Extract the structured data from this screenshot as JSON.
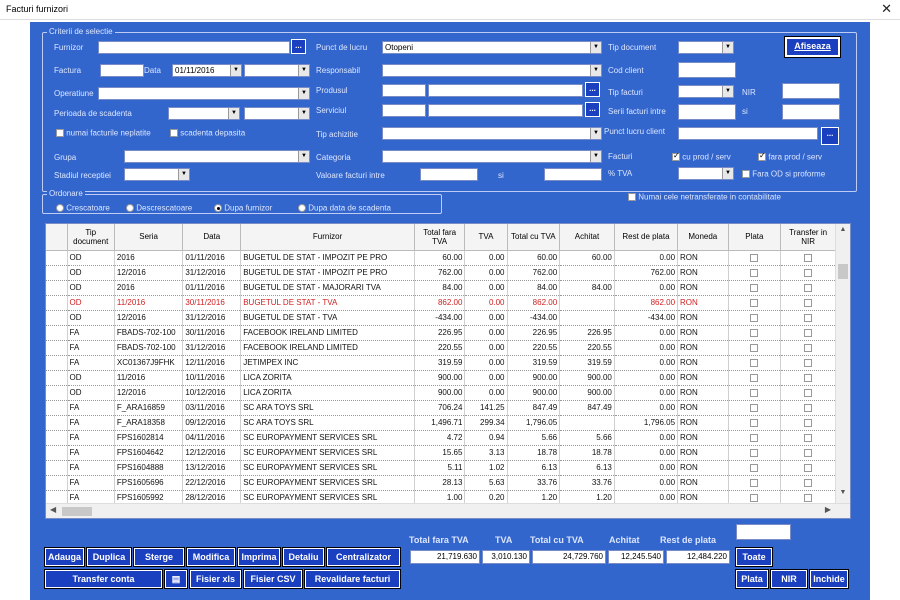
{
  "window": {
    "title": "Facturi furnizori",
    "close": "✕"
  },
  "criteria": {
    "caption": "Criterii de selectie",
    "furnizor_label": "Furnizor",
    "furnizor_value": "",
    "factura_label": "Factura",
    "data_label": "Data",
    "data_value": "01/11/2016",
    "operatiune_label": "Operatiune",
    "perioada_label": "Perioada de scadenta",
    "numai_neplatite": "numai facturile neplatite",
    "scadenta_depasita": "scadenta depasita",
    "grupa_label": "Grupa",
    "stadiul_label": "Stadiul receptiei",
    "punct_label": "Punct de lucru",
    "punct_value": "Otopeni",
    "responsabil_label": "Responsabil",
    "produsul_label": "Produsul",
    "serviciul_label": "Serviciul",
    "tip_achizitie_label": "Tip achizitie",
    "categoria_label": "Categoria",
    "valoare_label": "Valoare facturi intre",
    "si_label": "si",
    "tip_document_label": "Tip document",
    "cod_client_label": "Cod client",
    "tip_facturi_label": "Tip facturi",
    "nir_label": "NIR",
    "serii_label": "Serii facturi intre",
    "serii_si_label": "si",
    "punct_client_label": "Punct lucru client",
    "facturi_label": "Facturi",
    "cu_prod": "cu prod / serv",
    "fara_prod": "fara prod / serv",
    "tva_label": "% TVA",
    "fara_od": "Fara OD si proforme",
    "afiseaza": "Afiseaza"
  },
  "ordonare": {
    "caption": "Ordonare",
    "options": [
      "Crescatoare",
      "Descrescatoare",
      "Dupa furnizor",
      "Dupa data de scadenta"
    ],
    "numai_netransferate": "Numai cele netransferate in contabilitate"
  },
  "grid": {
    "headers": [
      "Tip document",
      "Seria",
      "Data",
      "Furnizor",
      "Total fara TVA",
      "TVA",
      "Total cu TVA",
      "Achitat",
      "Rest de plata",
      "Moneda",
      "Plata",
      "Transfer in NIR"
    ],
    "rows": [
      [
        "OD",
        "2016",
        "01/11/2016",
        "BUGETUL DE STAT - IMPOZIT PE PRO",
        "60.00",
        "0.00",
        "60.00",
        "60.00",
        "0.00",
        "RON"
      ],
      [
        "OD",
        "12/2016",
        "31/12/2016",
        "BUGETUL DE STAT - IMPOZIT PE PRO",
        "762.00",
        "0.00",
        "762.00",
        "",
        "762.00",
        "RON"
      ],
      [
        "OD",
        "2016",
        "01/11/2016",
        "BUGETUL DE STAT - MAJORARI TVA",
        "84.00",
        "0.00",
        "84.00",
        "84.00",
        "0.00",
        "RON"
      ],
      [
        "OD",
        "11/2016",
        "30/11/2016",
        "BUGETUL DE STAT - TVA",
        "862.00",
        "0.00",
        "862.00",
        "",
        "862.00",
        "RON"
      ],
      [
        "OD",
        "12/2016",
        "31/12/2016",
        "BUGETUL DE STAT - TVA",
        "-434.00",
        "0.00",
        "-434.00",
        "",
        "-434.00",
        "RON"
      ],
      [
        "FA",
        "FBADS-702-100",
        "30/11/2016",
        "FACEBOOK IRELAND LIMITED",
        "226.95",
        "0.00",
        "226.95",
        "226.95",
        "0.00",
        "RON"
      ],
      [
        "FA",
        "FBADS-702-100",
        "31/12/2016",
        "FACEBOOK IRELAND LIMITED",
        "220.55",
        "0.00",
        "220.55",
        "220.55",
        "0.00",
        "RON"
      ],
      [
        "FA",
        "XC01367J9FHK",
        "12/11/2016",
        "JETIMPEX INC",
        "319.59",
        "0.00",
        "319.59",
        "319.59",
        "0.00",
        "RON"
      ],
      [
        "OD",
        "11/2016",
        "10/11/2016",
        "LICA ZORITA",
        "900.00",
        "0.00",
        "900.00",
        "900.00",
        "0.00",
        "RON"
      ],
      [
        "OD",
        "12/2016",
        "10/12/2016",
        "LICA ZORITA",
        "900.00",
        "0.00",
        "900.00",
        "900.00",
        "0.00",
        "RON"
      ],
      [
        "FA",
        "F_ARA16859",
        "03/11/2016",
        "SC ARA TOYS SRL",
        "706.24",
        "141.25",
        "847.49",
        "847.49",
        "0.00",
        "RON"
      ],
      [
        "FA",
        "F_ARA18358",
        "09/12/2016",
        "SC ARA TOYS SRL",
        "1,496.71",
        "299.34",
        "1,796.05",
        "",
        "1,796.05",
        "RON"
      ],
      [
        "FA",
        "FPS1602814",
        "04/11/2016",
        "SC EUROPAYMENT SERVICES SRL",
        "4.72",
        "0.94",
        "5.66",
        "5.66",
        "0.00",
        "RON"
      ],
      [
        "FA",
        "FPS1604642",
        "12/12/2016",
        "SC EUROPAYMENT SERVICES SRL",
        "15.65",
        "3.13",
        "18.78",
        "18.78",
        "0.00",
        "RON"
      ],
      [
        "FA",
        "FPS1604888",
        "13/12/2016",
        "SC EUROPAYMENT SERVICES SRL",
        "5.11",
        "1.02",
        "6.13",
        "6.13",
        "0.00",
        "RON"
      ],
      [
        "FA",
        "FPS1605696",
        "22/12/2016",
        "SC EUROPAYMENT SERVICES SRL",
        "28.13",
        "5.63",
        "33.76",
        "33.76",
        "0.00",
        "RON"
      ],
      [
        "FA",
        "FPS1605992",
        "28/12/2016",
        "SC EUROPAYMENT SERVICES SRL",
        "1.00",
        "0.20",
        "1.20",
        "1.20",
        "0.00",
        "RON"
      ]
    ],
    "highlighted_row": 3,
    "highlight_color": "#d02020"
  },
  "totals": {
    "labels": [
      "Total fara TVA",
      "TVA",
      "Total cu TVA",
      "Achitat",
      "Rest de plata"
    ],
    "values": [
      "21,719.630",
      "3,010.130",
      "24,729.760",
      "12,245.540",
      "12,484.220"
    ]
  },
  "buttons": {
    "adauga": "Adauga",
    "duplica": "Duplica",
    "sterge": "Sterge",
    "modifica": "Modifica",
    "imprima": "Imprima",
    "detaliu": "Detaliu",
    "centralizator": "Centralizator",
    "transfer_conta": "Transfer conta",
    "fisier_xls": "Fisier xls",
    "fisier_csv": "Fisier CSV",
    "revalidare": "Revalidare facturi",
    "toate": "Toate",
    "plata": "Plata",
    "nir": "NIR",
    "inchide": "Inchide"
  },
  "colors": {
    "background": "#3366cc",
    "button": "#1a3fbf"
  }
}
